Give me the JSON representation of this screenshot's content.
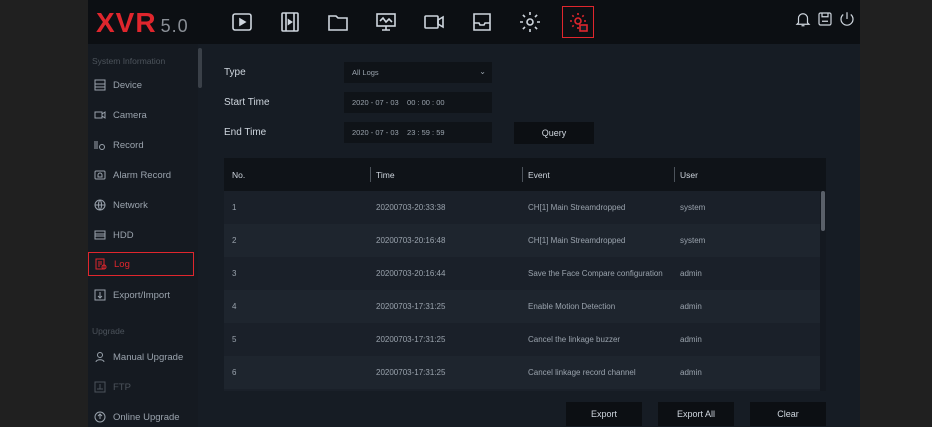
{
  "app": {
    "logo": "XVR",
    "version": "5.0"
  },
  "topnav": [
    {
      "name": "playback-icon"
    },
    {
      "name": "video-file-icon"
    },
    {
      "name": "folder-icon"
    },
    {
      "name": "monitor-icon"
    },
    {
      "name": "camera-icon"
    },
    {
      "name": "inbox-icon"
    },
    {
      "name": "gear-icon"
    },
    {
      "name": "system-settings-icon",
      "active": true
    }
  ],
  "right_icons": [
    "bell-icon",
    "save-icon",
    "power-icon"
  ],
  "sidebar": {
    "section1": "System Information",
    "section2": "Upgrade",
    "items": [
      {
        "label": "Device"
      },
      {
        "label": "Camera"
      },
      {
        "label": "Record"
      },
      {
        "label": "Alarm Record"
      },
      {
        "label": "Network"
      },
      {
        "label": "HDD"
      },
      {
        "label": "Log"
      },
      {
        "label": "Export/Import"
      },
      {
        "label": "Manual Upgrade"
      },
      {
        "label": "FTP"
      },
      {
        "label": "Online Upgrade"
      }
    ]
  },
  "filters": {
    "type_label": "Type",
    "type_value": "All Logs",
    "start_label": "Start Time",
    "start_value": "2020 - 07 - 03    00 : 00 : 00",
    "end_label": "End Time",
    "end_value": "2020 - 07 - 03    23 : 59 : 59",
    "query_label": "Query"
  },
  "table": {
    "headers": [
      "No.",
      "Time",
      "Event",
      "User"
    ],
    "rows": [
      [
        "1",
        "20200703-20:33:38",
        "CH[1] Main Streamdropped",
        "system"
      ],
      [
        "2",
        "20200703-20:16:48",
        "CH[1] Main Streamdropped",
        "system"
      ],
      [
        "3",
        "20200703-20:16:44",
        "Save the Face Compare configuration",
        "admin"
      ],
      [
        "4",
        "20200703-17:31:25",
        "Enable Motion Detection",
        "admin"
      ],
      [
        "5",
        "20200703-17:31:25",
        "Cancel the linkage buzzer",
        "admin"
      ],
      [
        "6",
        "20200703-17:31:25",
        "Cancel linkage record channel",
        "admin"
      ]
    ]
  },
  "actions": {
    "export": "Export",
    "export_all": "Export All",
    "clear": "Clear"
  },
  "colors": {
    "accent": "#e0262d",
    "background": "#161c24",
    "topbar": "#0c0f13"
  }
}
